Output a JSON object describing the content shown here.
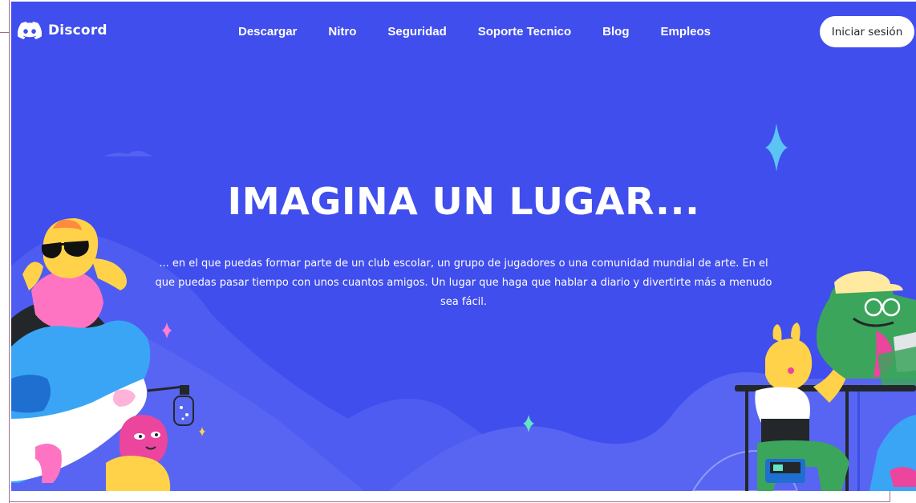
{
  "nav": {
    "brand": "Discord",
    "brand_icon": "discord-logo-icon",
    "links": [
      {
        "label": "Descargar"
      },
      {
        "label": "Nitro"
      },
      {
        "label": "Seguridad"
      },
      {
        "label": "Soporte Tecnico"
      },
      {
        "label": "Blog"
      },
      {
        "label": "Empleos"
      }
    ],
    "login_label": "Iniciar sesión"
  },
  "hero": {
    "headline": "IMAGINA UN LUGAR...",
    "description": "... en el que puedas formar parte de un club escolar, un grupo de jugadores o una comunidad mundial de arte. En el que puedas pasar tiempo con unos cuantos amigos. Un lugar que haga que hablar a diario y divertirte más a menudo sea fácil."
  },
  "colors": {
    "background": "#404eed",
    "hills": "#5865f2",
    "login_button_bg": "#ffffff",
    "login_button_text": "#23272a",
    "text": "#ffffff"
  }
}
